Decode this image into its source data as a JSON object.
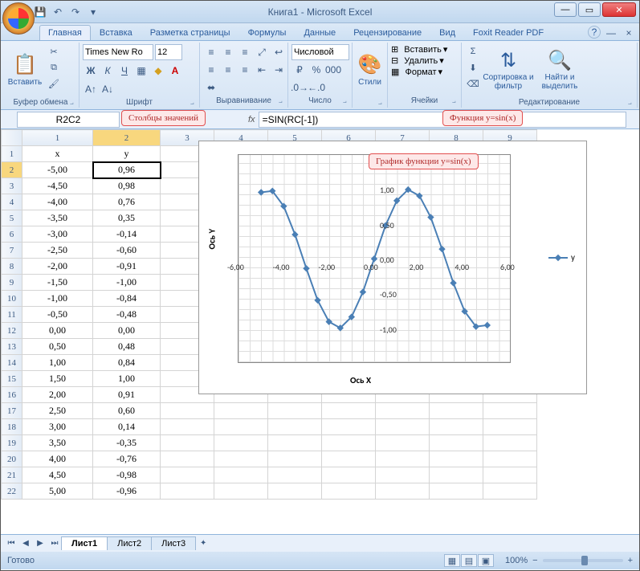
{
  "title": "Книга1 - Microsoft Excel",
  "tabs": [
    "Главная",
    "Вставка",
    "Разметка страницы",
    "Формулы",
    "Данные",
    "Рецензирование",
    "Вид",
    "Foxit Reader PDF"
  ],
  "ribbon": {
    "clipboard": {
      "paste": "Вставить",
      "label": "Буфер обмена"
    },
    "font": {
      "name": "Times New Ro",
      "size": "12",
      "label": "Шрифт"
    },
    "align": {
      "label": "Выравнивание"
    },
    "number": {
      "format": "Числовой",
      "label": "Число"
    },
    "styles": {
      "btn": "Стили",
      "label": ""
    },
    "cells": {
      "insert": "Вставить",
      "delete": "Удалить",
      "format": "Формат",
      "label": "Ячейки"
    },
    "edit": {
      "sort": "Сортировка и фильтр",
      "find": "Найти и выделить",
      "label": "Редактирование"
    }
  },
  "namebox": "R2C2",
  "formula": "=SIN(RC[-1])",
  "columns": [
    "1",
    "2",
    "3",
    "4",
    "5",
    "6",
    "7",
    "8",
    "9"
  ],
  "headers": {
    "x": "x",
    "y": "y"
  },
  "rows": [
    [
      "-5,00",
      "0,96"
    ],
    [
      "-4,50",
      "0,98"
    ],
    [
      "-4,00",
      "0,76"
    ],
    [
      "-3,50",
      "0,35"
    ],
    [
      "-3,00",
      "-0,14"
    ],
    [
      "-2,50",
      "-0,60"
    ],
    [
      "-2,00",
      "-0,91"
    ],
    [
      "-1,50",
      "-1,00"
    ],
    [
      "-1,00",
      "-0,84"
    ],
    [
      "-0,50",
      "-0,48"
    ],
    [
      "0,00",
      "0,00"
    ],
    [
      "0,50",
      "0,48"
    ],
    [
      "1,00",
      "0,84"
    ],
    [
      "1,50",
      "1,00"
    ],
    [
      "2,00",
      "0,91"
    ],
    [
      "2,50",
      "0,60"
    ],
    [
      "3,00",
      "0,14"
    ],
    [
      "3,50",
      "-0,35"
    ],
    [
      "4,00",
      "-0,76"
    ],
    [
      "4,50",
      "-0,98"
    ],
    [
      "5,00",
      "-0,96"
    ]
  ],
  "callouts": {
    "cols": "Столбцы значений",
    "func": "Функция y=sin(x)",
    "chart": "График функции y=sin(x)"
  },
  "chart_data": {
    "type": "line",
    "xlabel": "Ось X",
    "ylabel": "Ось Y",
    "xlim": [
      -6,
      6
    ],
    "ylim": [
      -1.5,
      1.5
    ],
    "xticks": [
      "-6,00",
      "-4,00",
      "-2,00",
      "0,00",
      "2,00",
      "4,00",
      "6,00"
    ],
    "yticks": [
      "1,00",
      "0,50",
      "0,00",
      "-0,50",
      "-1,00"
    ],
    "series": [
      {
        "name": "y",
        "x": [
          -5,
          -4.5,
          -4,
          -3.5,
          -3,
          -2.5,
          -2,
          -1.5,
          -1,
          -0.5,
          0,
          0.5,
          1,
          1.5,
          2,
          2.5,
          3,
          3.5,
          4,
          4.5,
          5
        ],
        "y": [
          0.96,
          0.98,
          0.76,
          0.35,
          -0.14,
          -0.6,
          -0.91,
          -1.0,
          -0.84,
          -0.48,
          0.0,
          0.48,
          0.84,
          1.0,
          0.91,
          0.6,
          0.14,
          -0.35,
          -0.76,
          -0.98,
          -0.96
        ]
      }
    ]
  },
  "sheets": [
    "Лист1",
    "Лист2",
    "Лист3"
  ],
  "status": "Готово",
  "zoom": "100%"
}
